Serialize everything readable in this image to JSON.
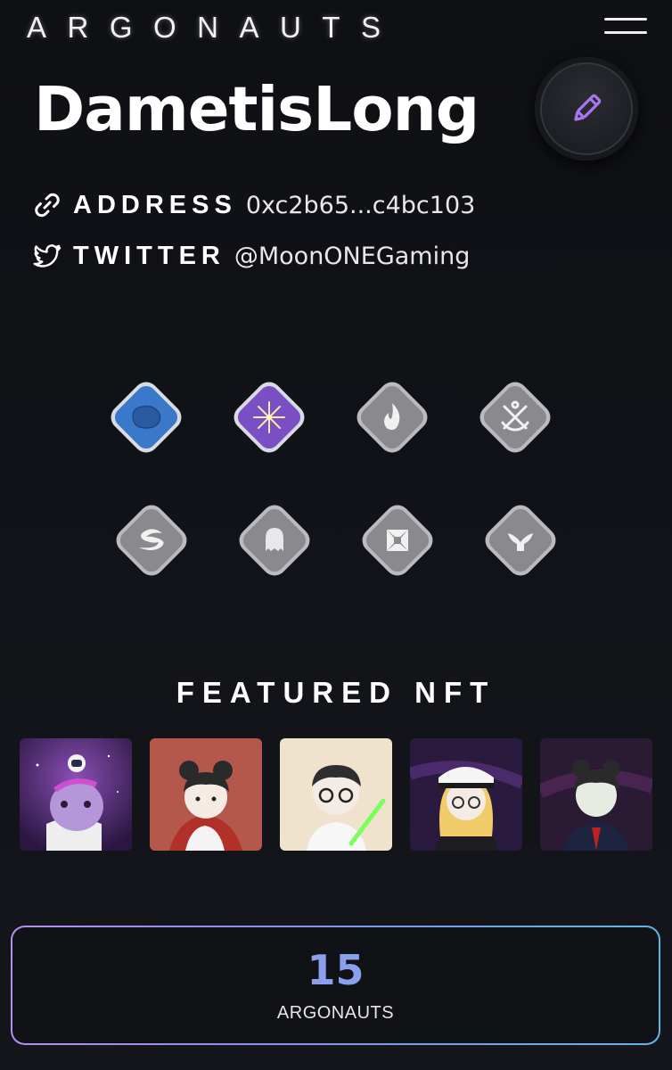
{
  "header": {
    "logo_text": "ARGONAUTS"
  },
  "profile": {
    "username": "DametisLong",
    "address_label": "ADDRESS",
    "address_value": "0xc2b65...c4bc103",
    "twitter_label": "TWITTER",
    "twitter_value": "@MoonONEGaming"
  },
  "badges": [
    {
      "name": "argonaut-head-icon",
      "state": "earned",
      "color": "#3a78c9"
    },
    {
      "name": "star-burst-icon",
      "state": "earned",
      "color": "#7a4fc4"
    },
    {
      "name": "flame-icon",
      "state": "locked",
      "color": "#8a8a8a"
    },
    {
      "name": "anchors-icon",
      "state": "locked",
      "color": "#8a8a8a"
    },
    {
      "name": "swirl-icon",
      "state": "locked",
      "color": "#8a8a8a"
    },
    {
      "name": "ghost-icon",
      "state": "locked",
      "color": "#8a8a8a"
    },
    {
      "name": "iron-cross-icon",
      "state": "locked",
      "color": "#8a8a8a"
    },
    {
      "name": "whale-tail-icon",
      "state": "locked",
      "color": "#8a8a8a"
    }
  ],
  "featured": {
    "title": "FEATURED NFT",
    "items": [
      {
        "name": "astronaut-argonaut",
        "bg": "#4a2a6e"
      },
      {
        "name": "bun-hair-red-cape",
        "bg": "#b3584a"
      },
      {
        "name": "glasses-lightsaber",
        "bg": "#efe3cd"
      },
      {
        "name": "captain-hat-blonde",
        "bg": "#2a1a3e"
      },
      {
        "name": "suit-bun-hair",
        "bg": "#2a1a34"
      }
    ]
  },
  "stats": {
    "count": "15",
    "label": "ARGONAUTS"
  },
  "colors": {
    "accent_purple": "#b58ef0",
    "accent_blue": "#5fb6e6",
    "background": "#111318"
  }
}
